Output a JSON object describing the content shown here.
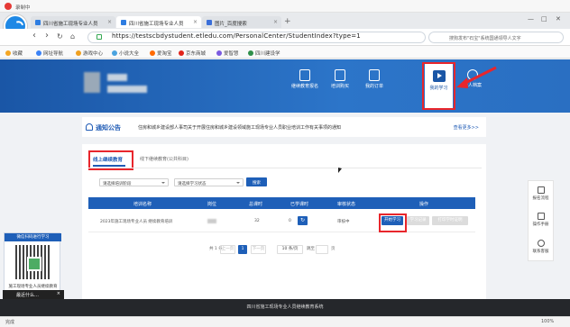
{
  "recorder": {
    "label": "录制中"
  },
  "browser": {
    "tabs": [
      {
        "label": "四川省施工现场专业人员"
      },
      {
        "label": "四川省施工现场专业人员"
      },
      {
        "label": "图片_百度搜索"
      }
    ],
    "url": "https://testscbdystudent.etledu.com/PersonalCenter/StudentIndex?type=1",
    "search_placeholder": "搜狗发布\"石宝\"系统国通领导人文字"
  },
  "bookmarks": [
    {
      "label": "收藏"
    },
    {
      "label": "网址导航"
    },
    {
      "label": "游戏中心"
    },
    {
      "label": "小说大全"
    },
    {
      "label": "爱淘宝"
    },
    {
      "label": "京东商城"
    },
    {
      "label": "爱智慧"
    },
    {
      "label": "四川建设学"
    }
  ],
  "nav": [
    {
      "label": "继续教育报名"
    },
    {
      "label": "培训购买"
    },
    {
      "label": "我的订单"
    },
    {
      "label": "我的学习"
    },
    {
      "label": "个人档案"
    }
  ],
  "notice": {
    "title": "通知公告",
    "text": "住房和城乡建设部人事司关于开展住房和城乡建设领域施工现场专业人员职业培训工作有关事项的通知",
    "more": "查看更多>>"
  },
  "tabs": {
    "tab1": "线上继续教育",
    "tab2": "线下继续教育(公共科目)"
  },
  "filters": {
    "filter1": "请选择培训阶段",
    "filter2": "请选择学习状态",
    "search_btn": "搜索"
  },
  "table": {
    "headers": [
      "培训名称",
      "岗位",
      "总课时",
      "已学课时",
      "审核状态",
      "操作"
    ],
    "rows": [
      {
        "name": "2023年施工现场专业人员 继续教育培训",
        "total": "32",
        "learned": "0",
        "status": "审核中",
        "action1": "开始学习",
        "action2": "学习记录",
        "action3": "打印学时证明"
      }
    ]
  },
  "pagination": {
    "total": "共 1 条",
    "prev": "上一页",
    "page": "1",
    "next": "下一页",
    "size": "10 条/页",
    "goto": "跳至",
    "page_unit": "页"
  },
  "qr": {
    "header": "微信扫码进行学习",
    "footer": "施工现场专业人员继续教育"
  },
  "qr_bar": {
    "label": "最近什么…"
  },
  "side": [
    {
      "label": "报名流程"
    },
    {
      "label": "操作手册"
    },
    {
      "label": "联系客服"
    }
  ],
  "footer": {
    "text": "四川省施工现场专业人员继续教育系统"
  },
  "status": {
    "left": "完成",
    "zoom": "100%"
  }
}
